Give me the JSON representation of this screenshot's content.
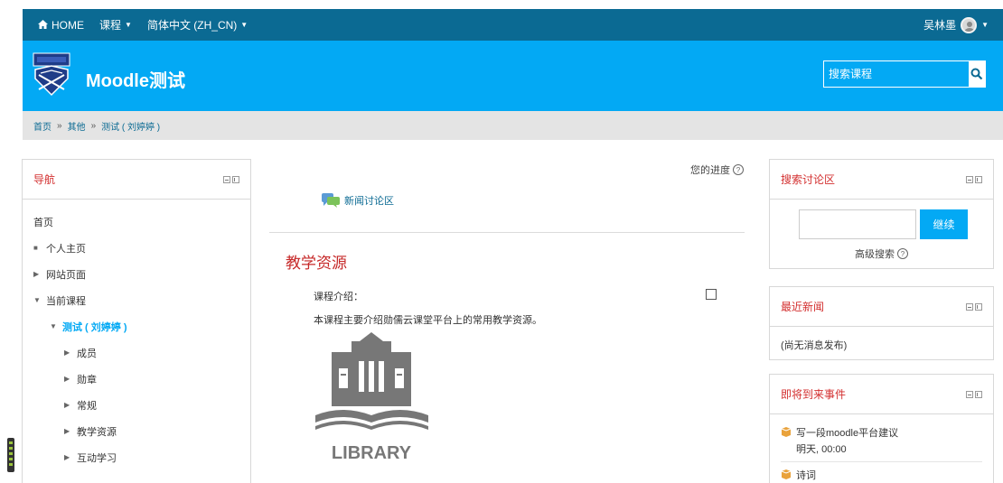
{
  "topbar": {
    "home": "HOME",
    "courses": "课程",
    "language": "简体中文 (ZH_CN)",
    "user_name": "吴林墨"
  },
  "header": {
    "site_title": "Moodle测试",
    "search_placeholder": "搜索课程"
  },
  "breadcrumb": {
    "items": [
      "首页",
      "其他",
      "测试 ( 刘婷婷 )"
    ],
    "separator": "»"
  },
  "navigation": {
    "title": "导航",
    "items": [
      {
        "label": "首页"
      },
      {
        "label": "个人主页"
      },
      {
        "label": "网站页面"
      },
      {
        "label": "当前课程"
      },
      {
        "label": "测试 ( 刘婷婷 )"
      },
      {
        "label": "成员"
      },
      {
        "label": "勋章"
      },
      {
        "label": "常规"
      },
      {
        "label": "教学资源"
      },
      {
        "label": "互动学习"
      }
    ]
  },
  "main": {
    "progress_label": "您的进度",
    "forum_link": "新闻讨论区",
    "section_title": "教学资源",
    "course_intro_label": "课程介绍：",
    "course_desc": "本课程主要介绍勋儒云课堂平台上的常用教学资源。",
    "library_text": "LIBRARY"
  },
  "search_forums": {
    "title": "搜索讨论区",
    "button": "继续",
    "advanced": "高级搜索"
  },
  "latest_news": {
    "title": "最近新闻",
    "text": "(尚无消息发布)"
  },
  "upcoming": {
    "title": "即将到来事件",
    "events": [
      {
        "name": "写一段moodle平台建议",
        "time": "明天, 00:00"
      },
      {
        "name": "诗词",
        "time": ""
      }
    ]
  },
  "colors": {
    "nav_dark": "#0b6a93",
    "header_blue": "#03a9f4",
    "accent_red": "#c62828"
  }
}
